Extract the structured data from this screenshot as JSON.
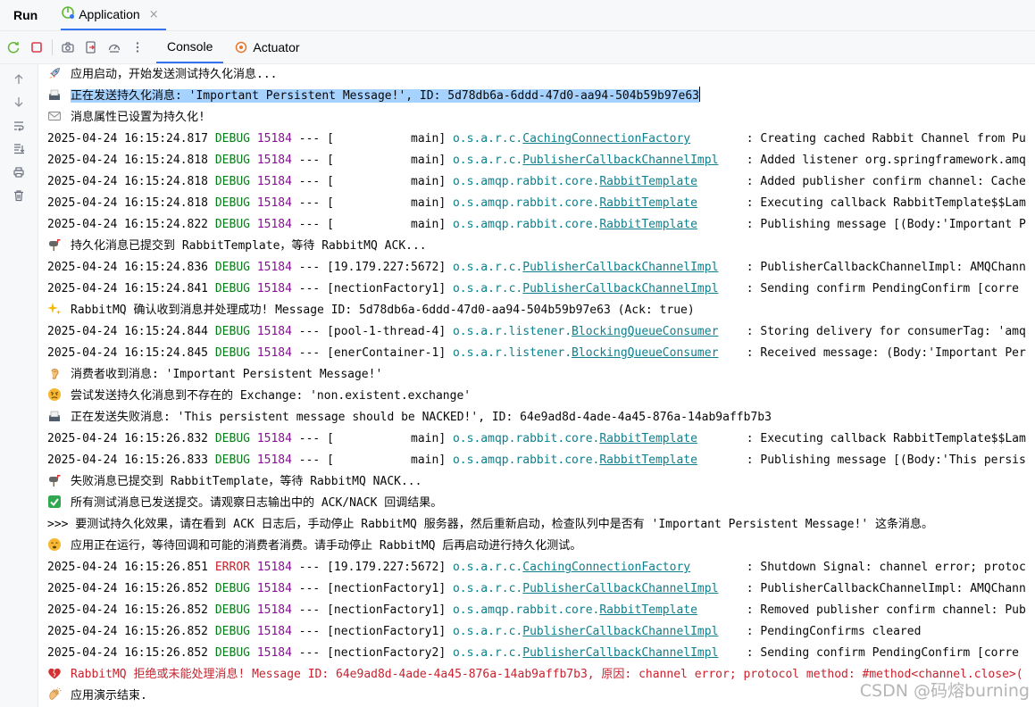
{
  "window": {
    "run_label": "Run",
    "app_tab": "Application",
    "close_glyph": "×"
  },
  "toolbar": {
    "tabs": [
      {
        "label": "Console",
        "active": true
      },
      {
        "label": "Actuator",
        "active": false
      }
    ],
    "icons": [
      "rerun-icon",
      "stop-icon",
      "camera-icon",
      "exit-icon",
      "dashboard-icon",
      "more-icon"
    ]
  },
  "gutter": {
    "icons": [
      "arrow-up-icon",
      "arrow-down-icon",
      "soft-wrap-icon",
      "scroll-to-end-icon",
      "print-icon",
      "trash-icon"
    ]
  },
  "colors": {
    "accent": "#3574f0",
    "debug": "#067d17",
    "error": "#c7222d",
    "pid": "#871094",
    "logger": "#0e7f8c",
    "selection": "#a6d2ff"
  },
  "console": {
    "lines": [
      {
        "kind": "msg",
        "icon": "rocket-icon",
        "text": "应用启动，开始发送测试持久化消息..."
      },
      {
        "kind": "msg",
        "icon": "outbox-icon",
        "text": "正在发送持久化消息: 'Important Persistent Message!', ID: 5d78db6a-6ddd-47d0-aa94-504b59b97e63",
        "highlight": true
      },
      {
        "kind": "msg",
        "icon": "envelope-icon",
        "text": "消息属性已设置为持久化!"
      },
      {
        "kind": "log",
        "ts": "2025-04-24 16:15:24.817",
        "level": "DEBUG",
        "pid": "15184",
        "sep": "---",
        "thread": "[           main]",
        "pkg": "o.s.a.r.c.",
        "cls": "CachingConnectionFactory",
        "pad": "       ",
        "msg": ": Creating cached Rabbit Channel from Pu"
      },
      {
        "kind": "log",
        "ts": "2025-04-24 16:15:24.818",
        "level": "DEBUG",
        "pid": "15184",
        "sep": "---",
        "thread": "[           main]",
        "pkg": "o.s.a.r.c.",
        "cls": "PublisherCallbackChannelImpl",
        "pad": "   ",
        "msg": ": Added listener org.springframework.amq"
      },
      {
        "kind": "log",
        "ts": "2025-04-24 16:15:24.818",
        "level": "DEBUG",
        "pid": "15184",
        "sep": "---",
        "thread": "[           main]",
        "pkg": "o.s.amqp.rabbit.core.",
        "cls": "RabbitTemplate",
        "pad": "      ",
        "msg": ": Added publisher confirm channel: Cache"
      },
      {
        "kind": "log",
        "ts": "2025-04-24 16:15:24.818",
        "level": "DEBUG",
        "pid": "15184",
        "sep": "---",
        "thread": "[           main]",
        "pkg": "o.s.amqp.rabbit.core.",
        "cls": "RabbitTemplate",
        "pad": "      ",
        "msg": ": Executing callback RabbitTemplate$$Lam"
      },
      {
        "kind": "log",
        "ts": "2025-04-24 16:15:24.822",
        "level": "DEBUG",
        "pid": "15184",
        "sep": "---",
        "thread": "[           main]",
        "pkg": "o.s.amqp.rabbit.core.",
        "cls": "RabbitTemplate",
        "pad": "      ",
        "msg": ": Publishing message [(Body:'Important P"
      },
      {
        "kind": "msg",
        "icon": "mailbox-icon",
        "text": "持久化消息已提交到 RabbitTemplate，等待 RabbitMQ ACK..."
      },
      {
        "kind": "log",
        "ts": "2025-04-24 16:15:24.836",
        "level": "DEBUG",
        "pid": "15184",
        "sep": "---",
        "thread": "[19.179.227:5672]",
        "pkg": "o.s.a.r.c.",
        "cls": "PublisherCallbackChannelImpl",
        "pad": "   ",
        "msg": ": PublisherCallbackChannelImpl: AMQChann"
      },
      {
        "kind": "log",
        "ts": "2025-04-24 16:15:24.841",
        "level": "DEBUG",
        "pid": "15184",
        "sep": "---",
        "thread": "[nectionFactory1]",
        "pkg": "o.s.a.r.c.",
        "cls": "PublisherCallbackChannelImpl",
        "pad": "   ",
        "msg": ": Sending confirm PendingConfirm [corre"
      },
      {
        "kind": "msg",
        "icon": "sparkles-icon",
        "text": "RabbitMQ 确认收到消息并处理成功! Message ID: 5d78db6a-6ddd-47d0-aa94-504b59b97e63 (Ack: true)"
      },
      {
        "kind": "log",
        "ts": "2025-04-24 16:15:24.844",
        "level": "DEBUG",
        "pid": "15184",
        "sep": "---",
        "thread": "[pool-1-thread-4]",
        "pkg": "o.s.a.r.listener.",
        "cls": "BlockingQueueConsumer",
        "pad": "   ",
        "msg": ": Storing delivery for consumerTag: 'amq"
      },
      {
        "kind": "log",
        "ts": "2025-04-24 16:15:24.845",
        "level": "DEBUG",
        "pid": "15184",
        "sep": "---",
        "thread": "[enerContainer-1]",
        "pkg": "o.s.a.r.listener.",
        "cls": "BlockingQueueConsumer",
        "pad": "   ",
        "msg": ": Received message: (Body:'Important Per"
      },
      {
        "kind": "msg",
        "icon": "ear-icon",
        "text": "消费者收到消息: 'Important Persistent Message!'"
      },
      {
        "kind": "msg",
        "icon": "angry-face-icon",
        "text": "尝试发送持久化消息到不存在的 Exchange: 'non.existent.exchange'"
      },
      {
        "kind": "msg",
        "icon": "outbox-icon",
        "text": "正在发送失败消息: 'This persistent message should be NACKED!', ID: 64e9ad8d-4ade-4a45-876a-14ab9affb7b3"
      },
      {
        "kind": "log",
        "ts": "2025-04-24 16:15:26.832",
        "level": "DEBUG",
        "pid": "15184",
        "sep": "---",
        "thread": "[           main]",
        "pkg": "o.s.amqp.rabbit.core.",
        "cls": "RabbitTemplate",
        "pad": "      ",
        "msg": ": Executing callback RabbitTemplate$$Lam"
      },
      {
        "kind": "log",
        "ts": "2025-04-24 16:15:26.833",
        "level": "DEBUG",
        "pid": "15184",
        "sep": "---",
        "thread": "[           main]",
        "pkg": "o.s.amqp.rabbit.core.",
        "cls": "RabbitTemplate",
        "pad": "      ",
        "msg": ": Publishing message [(Body:'This persis"
      },
      {
        "kind": "msg",
        "icon": "mailbox-icon",
        "text": "失败消息已提交到 RabbitTemplate，等待 RabbitMQ NACK..."
      },
      {
        "kind": "msg",
        "icon": "check-mark-icon",
        "text": "所有测试消息已发送提交。请观察日志输出中的 ACK/NACK 回调结果。"
      },
      {
        "kind": "msg",
        "icon": "",
        "text": ">>> 要测试持久化效果，请在看到 ACK 日志后，手动停止 RabbitMQ 服务器，然后重新启动，检查队列中是否有 'Important Persistent Message!' 这条消息。"
      },
      {
        "kind": "msg",
        "icon": "hourglass-face-icon",
        "text": "应用正在运行，等待回调和可能的消费者消费。请手动停止 RabbitMQ 后再启动进行持久化测试。"
      },
      {
        "kind": "log",
        "ts": "2025-04-24 16:15:26.851",
        "level": "ERROR",
        "pid": "15184",
        "sep": "---",
        "thread": "[19.179.227:5672]",
        "pkg": "o.s.a.r.c.",
        "cls": "CachingConnectionFactory",
        "pad": "       ",
        "msg": ": Shutdown Signal: channel error; protoc"
      },
      {
        "kind": "log",
        "ts": "2025-04-24 16:15:26.852",
        "level": "DEBUG",
        "pid": "15184",
        "sep": "---",
        "thread": "[nectionFactory1]",
        "pkg": "o.s.a.r.c.",
        "cls": "PublisherCallbackChannelImpl",
        "pad": "   ",
        "msg": ": PublisherCallbackChannelImpl: AMQChann"
      },
      {
        "kind": "log",
        "ts": "2025-04-24 16:15:26.852",
        "level": "DEBUG",
        "pid": "15184",
        "sep": "---",
        "thread": "[nectionFactory1]",
        "pkg": "o.s.amqp.rabbit.core.",
        "cls": "RabbitTemplate",
        "pad": "      ",
        "msg": ": Removed publisher confirm channel: Pub"
      },
      {
        "kind": "log",
        "ts": "2025-04-24 16:15:26.852",
        "level": "DEBUG",
        "pid": "15184",
        "sep": "---",
        "thread": "[nectionFactory1]",
        "pkg": "o.s.a.r.c.",
        "cls": "PublisherCallbackChannelImpl",
        "pad": "   ",
        "msg": ": PendingConfirms cleared"
      },
      {
        "kind": "log",
        "ts": "2025-04-24 16:15:26.852",
        "level": "DEBUG",
        "pid": "15184",
        "sep": "---",
        "thread": "[nectionFactory2]",
        "pkg": "o.s.a.r.c.",
        "cls": "PublisherCallbackChannelImpl",
        "pad": "   ",
        "msg": ": Sending confirm PendingConfirm [corre"
      },
      {
        "kind": "err",
        "icon": "broken-heart-icon",
        "text": "RabbitMQ 拒绝或未能处理消息! Message ID: 64e9ad8d-4ade-4a45-876a-14ab9affb7b3, 原因: channel error; protocol method: #method<channel.close>("
      },
      {
        "kind": "msg",
        "icon": "clapping-hands-icon",
        "text": "应用演示结束."
      }
    ]
  },
  "watermark": "CSDN @码熔burning"
}
